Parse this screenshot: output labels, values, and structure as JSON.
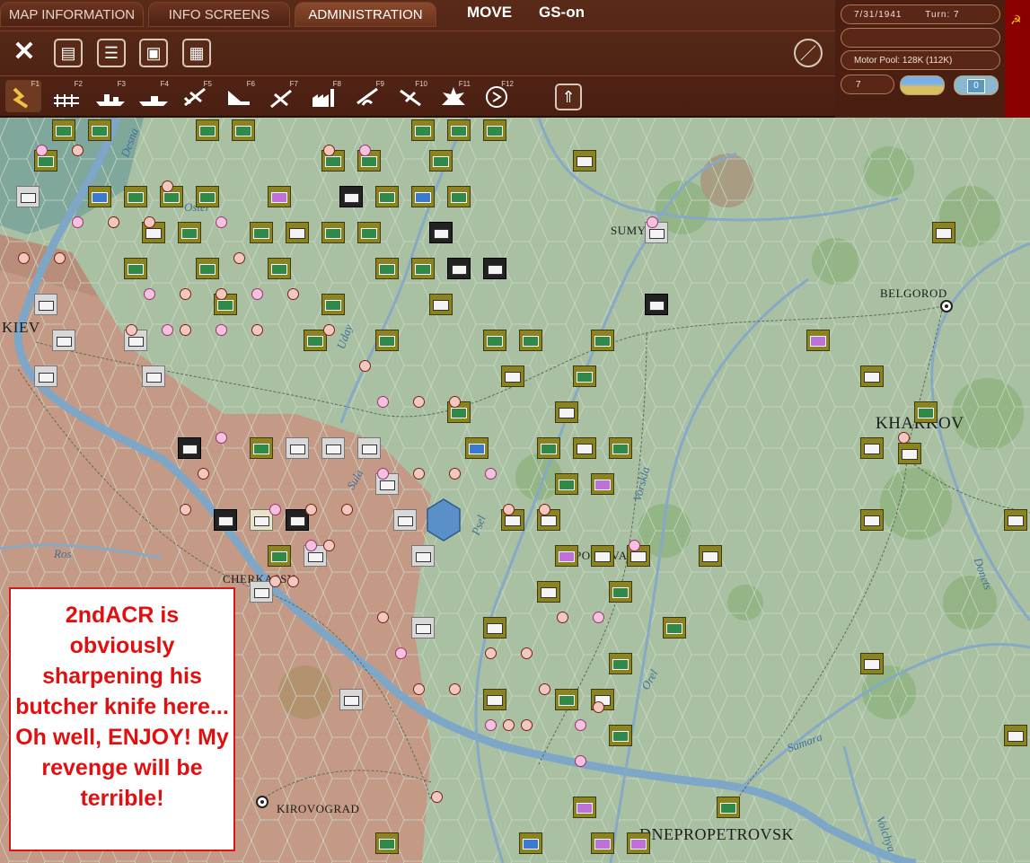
{
  "tabs": [
    {
      "label": "MAP INFORMATION",
      "active": false
    },
    {
      "label": "INFO SCREENS",
      "active": false
    },
    {
      "label": "ADMINISTRATION",
      "active": true
    }
  ],
  "mode_label": "MOVE",
  "gs_label": "GS-on",
  "info": {
    "date": "7/31/1941",
    "turn": "Turn: 7",
    "motor_pool": "Motor Pool:  128K (112K)",
    "value": "7",
    "counter": "0"
  },
  "toolbar_icons": [
    "close-icon",
    "report-icon",
    "list-icon",
    "save-icon",
    "grid-icon",
    "pencil-icon"
  ],
  "function_keys": [
    "F1",
    "F2",
    "F3",
    "F4",
    "F5",
    "F6",
    "F7",
    "F8",
    "F9",
    "F10",
    "F11",
    "F12"
  ],
  "cities": [
    "KIEV",
    "SUMY",
    "BELGOROD",
    "KHARKOV",
    "POLTAVA",
    "CHERKASSY",
    "KIROVOGRAD",
    "DNEPROPETROVSK"
  ],
  "rivers": [
    "Desna",
    "Oster",
    "Uday",
    "Sula",
    "Psel",
    "Vorskla",
    "Ros",
    "Orel",
    "Donets",
    "Samara",
    "Volchya"
  ],
  "comment": "2ndACR is obviously sharpening his butcher knife here... Oh well, ENJOY! My revenge will be terrible!",
  "colors": {
    "axis_unit": "#8a8320",
    "soviet_unit": "#d8d8d8",
    "frame": "#4a1f12",
    "comment_text": "#e01010"
  }
}
